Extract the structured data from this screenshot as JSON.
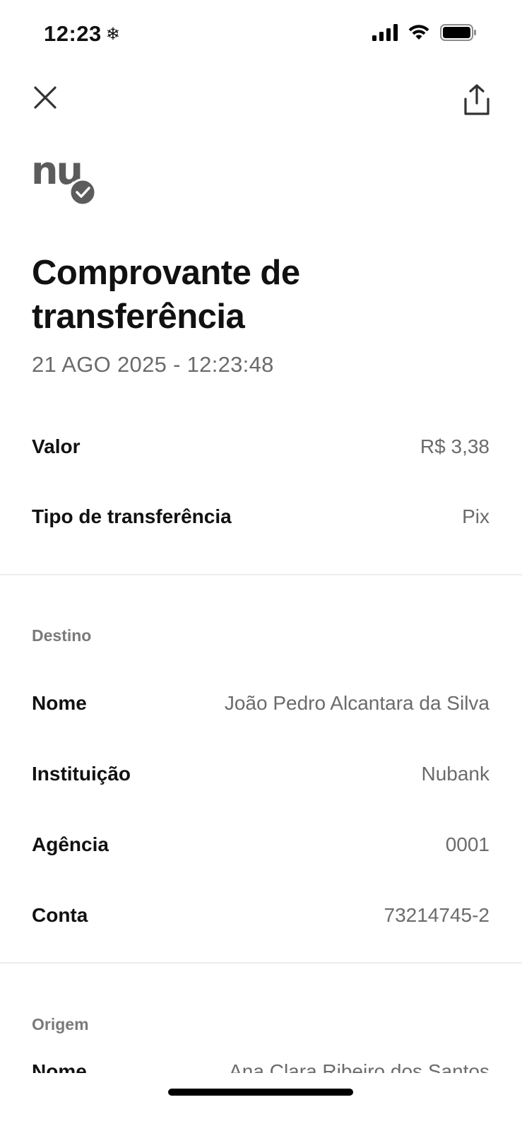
{
  "status_bar": {
    "time": "12:23",
    "time_icon": "snowflake-icon",
    "icons": [
      "cellular-signal-icon",
      "wifi-icon",
      "battery-icon"
    ]
  },
  "nav": {
    "close_icon": "close-icon",
    "share_icon": "share-icon"
  },
  "logo": {
    "text": "nu",
    "badge_icon": "verified-check-icon"
  },
  "receipt": {
    "title": "Comprovante de transferência",
    "datetime": "21 AGO 2025 - 12:23:48",
    "summary": [
      {
        "label": "Valor",
        "value": "R$ 3,38"
      },
      {
        "label": "Tipo de transferência",
        "value": "Pix"
      }
    ],
    "destino": {
      "title": "Destino",
      "rows": [
        {
          "label": "Nome",
          "value": "João Pedro Alcantara da Silva"
        },
        {
          "label": "Instituição",
          "value": "Nubank"
        },
        {
          "label": "Agência",
          "value": "0001"
        },
        {
          "label": "Conta",
          "value": "73214745-2"
        }
      ]
    },
    "origem": {
      "title": "Origem",
      "rows": [
        {
          "label": "Nome",
          "value": "Ana Clara Ribeiro dos Santos"
        }
      ]
    }
  },
  "colors": {
    "background": "#ffffff",
    "label": "#111111",
    "value": "#6b6b6b",
    "section_title": "#7a7a7a",
    "divider": "#ededed",
    "logo": "#5c5c5c"
  }
}
